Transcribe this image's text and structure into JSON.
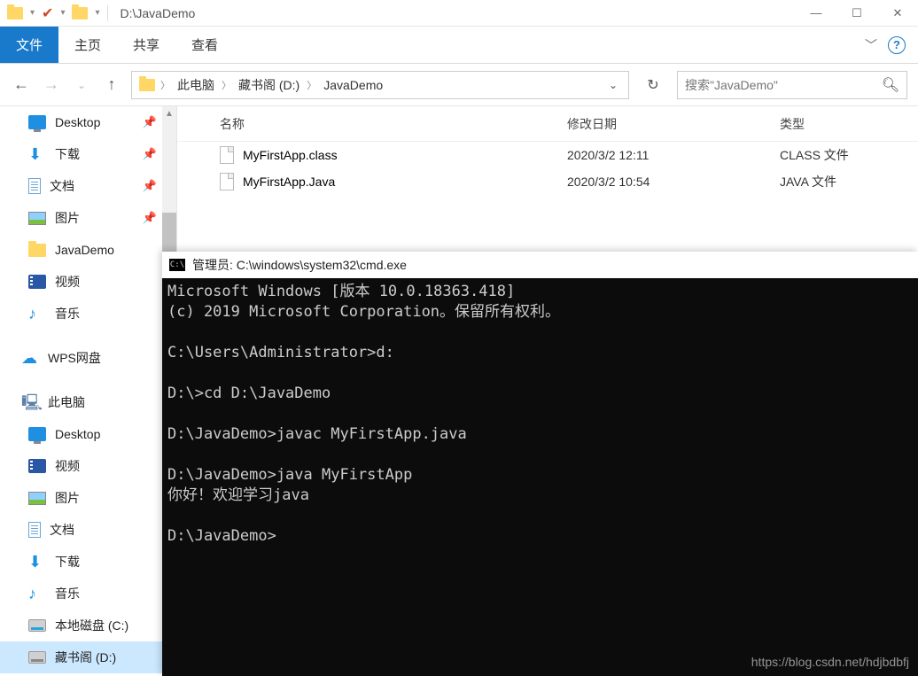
{
  "titlebar": {
    "path": "D:\\JavaDemo"
  },
  "ribbon": {
    "file": "文件",
    "tabs": [
      "主页",
      "共享",
      "查看"
    ]
  },
  "breadcrumb": {
    "items": [
      "此电脑",
      "藏书阁 (D:)",
      "JavaDemo"
    ]
  },
  "search": {
    "placeholder": "搜索\"JavaDemo\""
  },
  "sidebar": {
    "group1": [
      {
        "label": "Desktop",
        "icon": "monitor",
        "pinned": true
      },
      {
        "label": "下载",
        "icon": "down-arrow",
        "pinned": true
      },
      {
        "label": "文档",
        "icon": "doc",
        "pinned": true
      },
      {
        "label": "图片",
        "icon": "pic",
        "pinned": true
      },
      {
        "label": "JavaDemo",
        "icon": "folder",
        "pinned": false
      },
      {
        "label": "视频",
        "icon": "video",
        "pinned": false
      },
      {
        "label": "音乐",
        "icon": "music",
        "pinned": false
      }
    ],
    "wps": "WPS网盘",
    "thispc": "此电脑",
    "group2": [
      {
        "label": "Desktop",
        "icon": "monitor"
      },
      {
        "label": "视频",
        "icon": "video"
      },
      {
        "label": "图片",
        "icon": "pic"
      },
      {
        "label": "文档",
        "icon": "doc"
      },
      {
        "label": "下载",
        "icon": "down-arrow"
      },
      {
        "label": "音乐",
        "icon": "music"
      },
      {
        "label": "本地磁盘 (C:)",
        "icon": "disk c"
      },
      {
        "label": "藏书阁 (D:)",
        "icon": "disk d"
      }
    ]
  },
  "columns": {
    "name": "名称",
    "date": "修改日期",
    "type": "类型"
  },
  "files": [
    {
      "name": "MyFirstApp.class",
      "date": "2020/3/2 12:11",
      "type": "CLASS 文件"
    },
    {
      "name": "MyFirstApp.Java",
      "date": "2020/3/2 10:54",
      "type": "JAVA 文件"
    }
  ],
  "cmd": {
    "title": "管理员: C:\\windows\\system32\\cmd.exe",
    "lines": "Microsoft Windows [版本 10.0.18363.418]\n(c) 2019 Microsoft Corporation。保留所有权利。\n\nC:\\Users\\Administrator>d:\n\nD:\\>cd D:\\JavaDemo\n\nD:\\JavaDemo>javac MyFirstApp.java\n\nD:\\JavaDemo>java MyFirstApp\n你好！欢迎学习java\n\nD:\\JavaDemo>"
  },
  "watermark": "https://blog.csdn.net/hdjbdbfj"
}
